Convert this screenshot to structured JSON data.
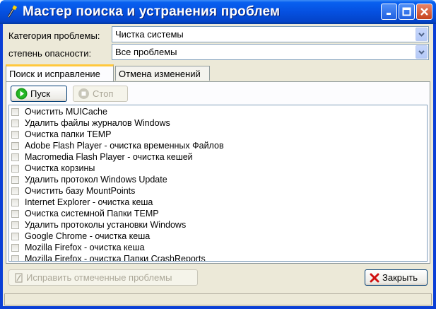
{
  "window": {
    "title": "Мастер поиска и устранения проблем",
    "caption": {
      "minimize": "_",
      "maximize": "□",
      "close": "✕"
    }
  },
  "filters": {
    "category_label": "Категория проблемы:",
    "category_value": "Чистка системы",
    "severity_label": "степень опасности:",
    "severity_value": "Все проблемы"
  },
  "tabs": [
    {
      "label": "Поиск и исправление",
      "active": true
    },
    {
      "label": "Отмена изменений",
      "active": false
    }
  ],
  "toolbar": {
    "start_label": "Пуск",
    "stop_label": "Стоп"
  },
  "items": [
    {
      "label": "Очистить MUICache",
      "checked": false
    },
    {
      "label": "Удалить файлы журналов Windows",
      "checked": false
    },
    {
      "label": "Очистка папки TEMP",
      "checked": false
    },
    {
      "label": "Adobe Flash Player - очистка временных Файлов",
      "checked": false
    },
    {
      "label": "Macromedia Flash Player - очистка кешей",
      "checked": false
    },
    {
      "label": "Очистка корзины",
      "checked": false
    },
    {
      "label": "Удалить протокол Windows Update",
      "checked": false
    },
    {
      "label": "Очистить базу MountPoints",
      "checked": false
    },
    {
      "label": "Internet Explorer - очистка кеша",
      "checked": false
    },
    {
      "label": "Очистка системной Папки TEMP",
      "checked": false
    },
    {
      "label": "Удалить протоколы установки Windows",
      "checked": false
    },
    {
      "label": "Google Chrome - очистка кеша",
      "checked": false
    },
    {
      "label": "Mozilla Firefox - очистка кеша",
      "checked": false
    },
    {
      "label": "Mozilla Firefox - очистка Папки CrashReports",
      "checked": false
    }
  ],
  "footer": {
    "fix_label": "Исправить отмеченные проблемы",
    "close_label": "Закрыть"
  },
  "colors": {
    "titlebar": "#0550e0",
    "tab_highlight": "#ffc83c",
    "start_icon": "#1a9a1a",
    "close_icon": "#d01010"
  }
}
